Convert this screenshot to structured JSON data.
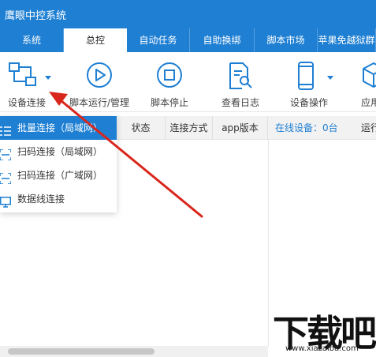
{
  "app": {
    "title": "鹰眼中控系统"
  },
  "tabs": [
    {
      "label": "系统"
    },
    {
      "label": "总控"
    },
    {
      "label": "自动任务"
    },
    {
      "label": "自助换绑"
    },
    {
      "label": "脚本市场"
    },
    {
      "label": "苹果免越狱群"
    }
  ],
  "toolbar": {
    "device_connect": "设备连接",
    "script_run": "脚本运行/管理",
    "script_stop": "脚本停止",
    "view_log": "查看日志",
    "device_ops": "设备操作",
    "app_partial": "应用"
  },
  "table": {
    "headers": [
      "状态",
      "连接方式",
      "app版本"
    ],
    "online_devices": "在线设备：0台",
    "run_partial": "运行"
  },
  "dropdown": {
    "items": [
      "批量连接（局域网）",
      "扫码连接（局域网）",
      "扫码连接（广域网）",
      "数据线连接"
    ]
  },
  "colors": {
    "accent": "#1e7fd3",
    "annotation_arrow": "#d9261c"
  },
  "watermark": {
    "text": "下载吧",
    "url": "www.xiazaiba.com"
  }
}
